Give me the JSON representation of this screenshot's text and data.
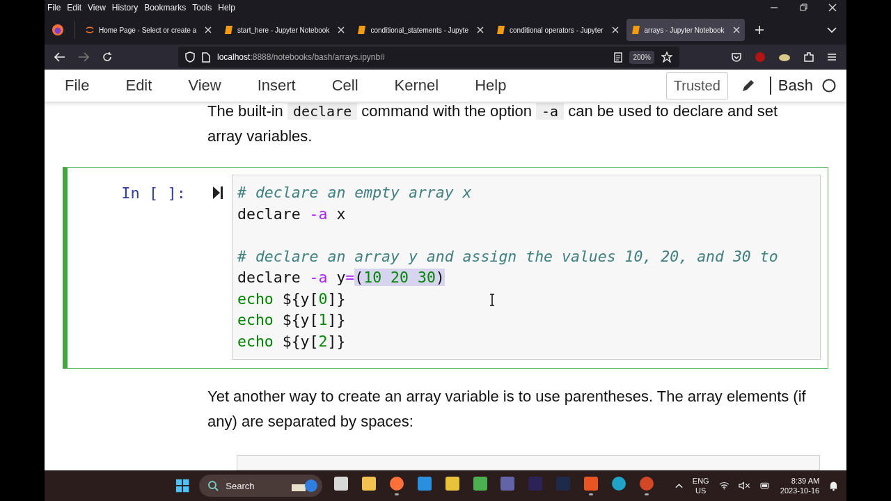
{
  "menu_bar": [
    "File",
    "Edit",
    "View",
    "History",
    "Bookmarks",
    "Tools",
    "Help"
  ],
  "tabs": [
    {
      "title": "Home Page - Select or create a",
      "kind": "jupyter",
      "selected": false
    },
    {
      "title": "start_here - Jupyter Notebook",
      "kind": "notebook",
      "selected": false
    },
    {
      "title": "conditional_statements - Jupyte",
      "kind": "notebook",
      "selected": false
    },
    {
      "title": "conditional operators - Jupyter",
      "kind": "notebook",
      "selected": false
    },
    {
      "title": "arrays - Jupyter Notebook",
      "kind": "notebook",
      "selected": true
    }
  ],
  "address_bar": {
    "host": "localhost",
    "path": ":8888/notebooks/bash/arrays.ipynb#",
    "zoom": "200%"
  },
  "notebook_menu": [
    "File",
    "Edit",
    "View",
    "Insert",
    "Cell",
    "Kernel",
    "Help"
  ],
  "notebook_status": {
    "trusted": "Trusted",
    "kernel": "Bash"
  },
  "paragraph_1": [
    {
      "text": "The built-in ",
      "code": false
    },
    {
      "text": "declare",
      "code": true
    },
    {
      "text": " command with the option ",
      "code": false
    },
    {
      "text": "-a",
      "code": true
    },
    {
      "text": " can be used to declare and set array variables.",
      "code": false
    }
  ],
  "cell": {
    "prompt": "In [ ]:",
    "selected": true,
    "lines": [
      {
        "kind": "comment",
        "gap_before": false,
        "parts": [
          {
            "text": "# declare an empty array x",
            "selected": false
          }
        ]
      },
      {
        "kind": "code",
        "gap_before": false,
        "parts": [
          {
            "text": "declare -a x",
            "selected": false
          }
        ]
      },
      {
        "kind": "comment",
        "gap_before": true,
        "parts": [
          {
            "text": "# declare an array y and assign the values 10, 20, and 30 to",
            "selected": false
          }
        ]
      },
      {
        "kind": "code",
        "gap_before": false,
        "parts": [
          {
            "text": "declare -a y=",
            "selected": false
          },
          {
            "text": "(10 20 30)",
            "selected": true
          }
        ]
      },
      {
        "kind": "code",
        "gap_before": false,
        "parts": [
          {
            "text": "echo ${y[0]}",
            "selected": false
          }
        ]
      },
      {
        "kind": "code",
        "gap_before": false,
        "parts": [
          {
            "text": "echo ${y[1]}",
            "selected": false
          }
        ]
      },
      {
        "kind": "code",
        "gap_before": false,
        "parts": [
          {
            "text": "echo ${y[2]}",
            "selected": false
          }
        ]
      }
    ]
  },
  "paragraph_2": "Yet another way to create an array variable is to use parentheses. The array elements (if any) are separated by spaces:",
  "taskbar": {
    "search": "Search",
    "apps": [
      {
        "kind": "files",
        "running": false
      },
      {
        "kind": "folder",
        "running": false
      },
      {
        "kind": "firefox",
        "running": true
      },
      {
        "kind": "vscode",
        "running": false
      },
      {
        "kind": "tool",
        "running": false
      },
      {
        "kind": "network",
        "running": false
      },
      {
        "kind": "teams",
        "running": false
      },
      {
        "kind": "eclipse",
        "running": false
      },
      {
        "kind": "terminal",
        "running": false
      },
      {
        "kind": "ubuntu",
        "running": true
      },
      {
        "kind": "edge",
        "running": false
      },
      {
        "kind": "powerpoint",
        "running": true
      }
    ],
    "language": [
      "ENG",
      "US"
    ],
    "time": "8:39 AM",
    "date": "2023-10-16"
  }
}
